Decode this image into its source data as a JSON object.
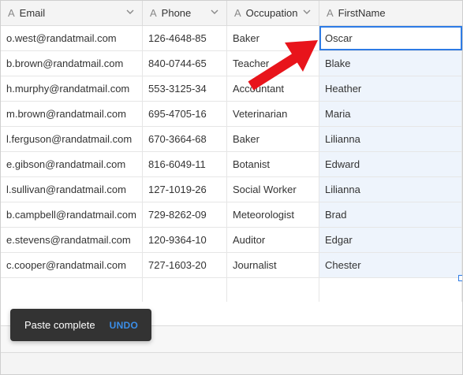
{
  "columns": [
    {
      "label": "Email",
      "type_icon": "A"
    },
    {
      "label": "Phone",
      "type_icon": "A"
    },
    {
      "label": "Occupation",
      "type_icon": "A"
    },
    {
      "label": "FirstName",
      "type_icon": "A"
    }
  ],
  "rows": [
    {
      "email": "o.west@randatmail.com",
      "phone": "126-4648-85",
      "occupation": "Baker",
      "firstname": "Oscar"
    },
    {
      "email": "b.brown@randatmail.com",
      "phone": "840-0744-65",
      "occupation": "Teacher",
      "firstname": "Blake"
    },
    {
      "email": "h.murphy@randatmail.com",
      "phone": "553-3125-34",
      "occupation": "Accountant",
      "firstname": "Heather"
    },
    {
      "email": "m.brown@randatmail.com",
      "phone": "695-4705-16",
      "occupation": "Veterinarian",
      "firstname": "Maria"
    },
    {
      "email": "l.ferguson@randatmail.com",
      "phone": "670-3664-68",
      "occupation": "Baker",
      "firstname": "Lilianna"
    },
    {
      "email": "e.gibson@randatmail.com",
      "phone": "816-6049-11",
      "occupation": "Botanist",
      "firstname": "Edward"
    },
    {
      "email": "l.sullivan@randatmail.com",
      "phone": "127-1019-26",
      "occupation": "Social Worker",
      "firstname": "Lilianna"
    },
    {
      "email": "b.campbell@randatmail.com",
      "phone": "729-8262-09",
      "occupation": "Meteorologist",
      "firstname": "Brad"
    },
    {
      "email": "e.stevens@randatmail.com",
      "phone": "120-9364-10",
      "occupation": "Auditor",
      "firstname": "Edgar"
    },
    {
      "email": "c.cooper@randatmail.com",
      "phone": "727-1603-20",
      "occupation": "Journalist",
      "firstname": "Chester"
    }
  ],
  "toast": {
    "message": "Paste complete",
    "action": "UNDO"
  },
  "colors": {
    "selection": "#2d7be5",
    "highlight": "#eef4fc",
    "arrow": "#e8141b",
    "toast_bg": "#333333",
    "undo": "#3b8ee8"
  },
  "icons": {
    "column_type": "text-type-icon",
    "column_menu": "chevron-down-icon",
    "annotation": "red-arrow-icon"
  }
}
